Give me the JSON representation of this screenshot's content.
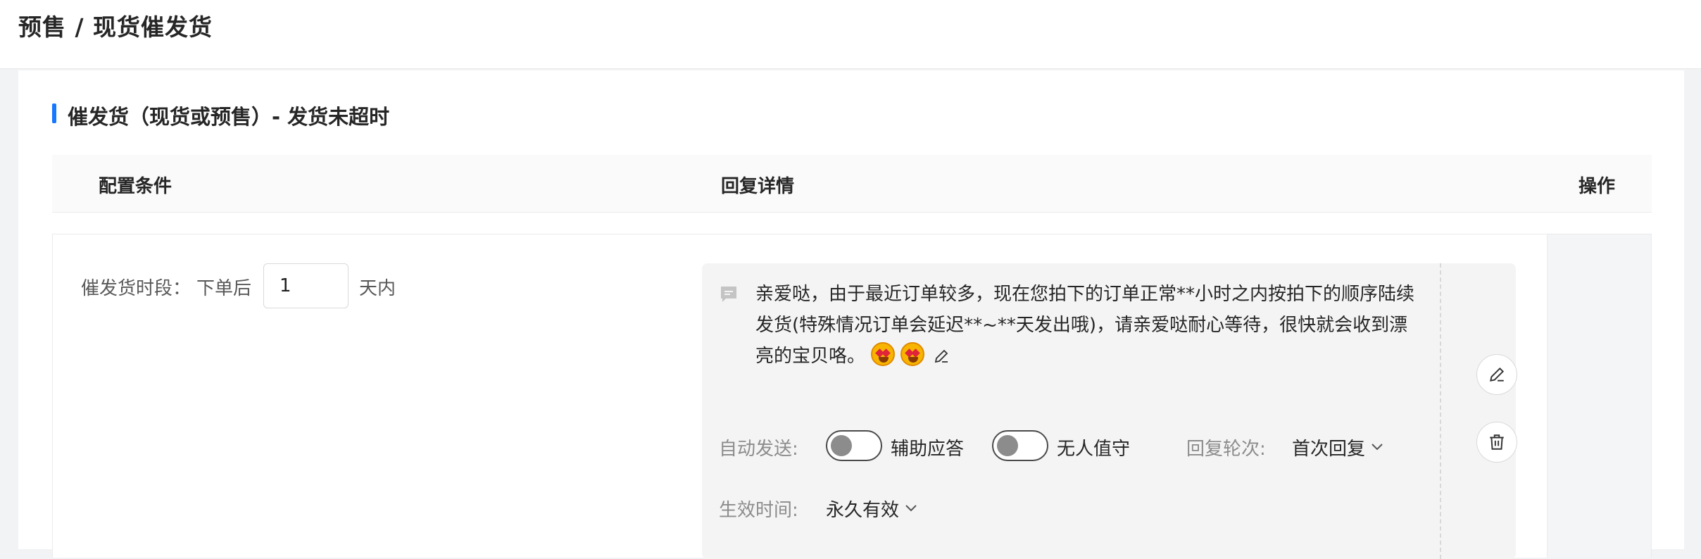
{
  "header": {
    "title": "预售 / 现货催发货"
  },
  "section": {
    "title": "催发货（现货或预售）- 发货未超时"
  },
  "table": {
    "columns": [
      "配置条件",
      "回复详情",
      "操作"
    ]
  },
  "row": {
    "condition": {
      "label": "催发货时段：",
      "after": "下单后",
      "days_value": "1",
      "within": "天内"
    },
    "reply": {
      "message": "亲爱哒，由于最近订单较多，现在您拍下的订单正常**小时之内按拍下的顺序陆续发货(特殊情况订单会延迟**~**天发出哦)，请亲爱哒耐心等待，很快就会收到漂亮的宝贝咯。",
      "emoji_count": 2,
      "auto_send_label": "自动发送:",
      "assist_label": "辅助应答",
      "assist_on": false,
      "unattended_label": "无人值守",
      "unattended_on": false,
      "round_label": "回复轮次:",
      "round_value": "首次回复",
      "effective_label": "生效时间:",
      "effective_value": "永久有效"
    }
  },
  "colors": {
    "accent": "#1677ff",
    "emoji": "#f7b500"
  },
  "icons": [
    "message-icon",
    "edit-icon",
    "delete-icon",
    "chevron-down-icon",
    "star-struck-emoji"
  ]
}
